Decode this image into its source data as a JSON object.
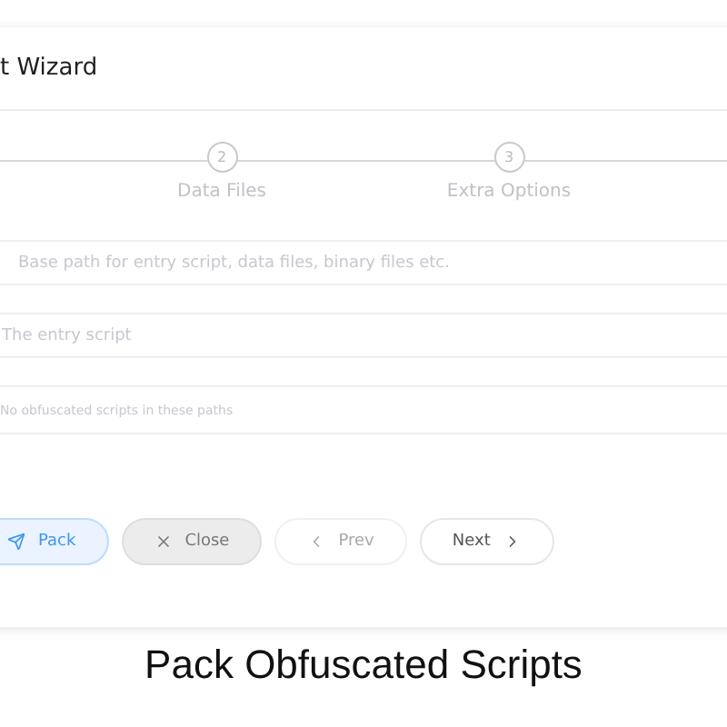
{
  "dialog": {
    "title": "t Wizard"
  },
  "steps": [
    {
      "number": "2",
      "label": "Data Files"
    },
    {
      "number": "3",
      "label": "Extra Options"
    }
  ],
  "fields": [
    {
      "placeholder": "Base path for entry script, data files, binary files etc.",
      "kind": "text"
    },
    {
      "placeholder": "The entry script",
      "kind": "text"
    },
    {
      "placeholder": "No obfuscated scripts in these paths",
      "kind": "small"
    }
  ],
  "buttons": [
    {
      "label": "Pack",
      "kind": "pack",
      "disabled": false
    },
    {
      "label": "Close",
      "kind": "close",
      "disabled": false
    },
    {
      "label": "Prev",
      "kind": "prev",
      "disabled": true
    },
    {
      "label": "Next",
      "kind": "next",
      "disabled": false
    }
  ],
  "caption": "Pack Obfuscated Scripts"
}
